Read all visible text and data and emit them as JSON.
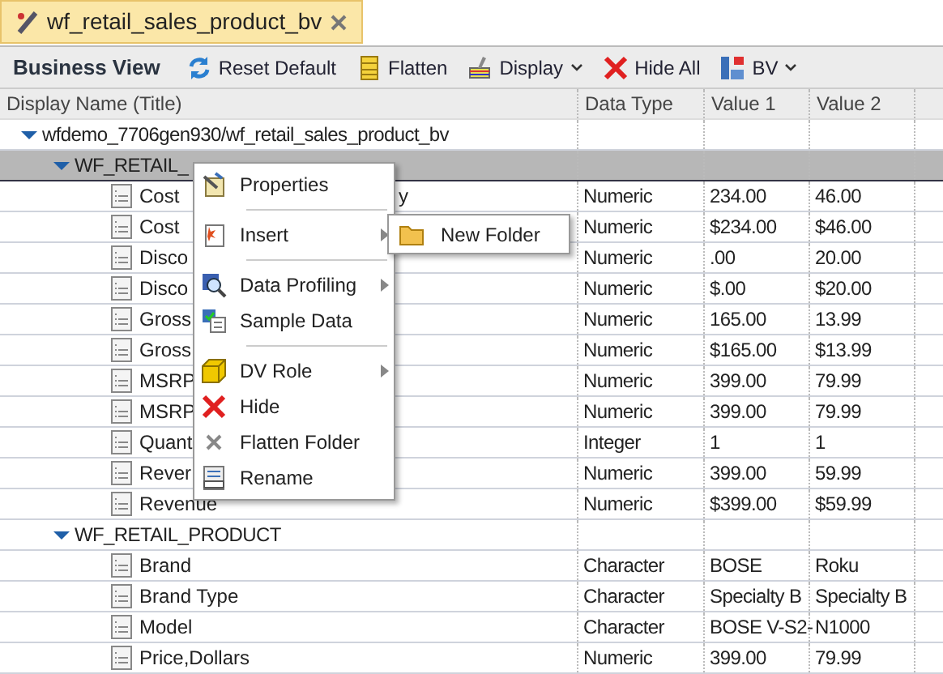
{
  "tab": {
    "title": "wf_retail_sales_product_bv",
    "selected": true
  },
  "toolbar": {
    "title": "Business View",
    "buttons": [
      {
        "label": "Reset Default",
        "dropdown": false
      },
      {
        "label": "Flatten",
        "dropdown": false
      },
      {
        "label": "Display",
        "dropdown": true
      },
      {
        "label": "Hide All",
        "dropdown": false
      },
      {
        "label": "BV",
        "dropdown": true
      }
    ]
  },
  "columns": [
    "Display Name (Title)",
    "Data Type",
    "Value 1",
    "Value 2"
  ],
  "tree": [
    {
      "name": "wfdemo_7706gen930/wf_retail_sales_product_bv",
      "kind": "folder",
      "expanded": true,
      "selected": false,
      "children": [
        {
          "name": "WF_RETAIL_",
          "kind": "folder",
          "expanded": true,
          "selected": true,
          "children": [
            {
              "name": "Cost",
              "tail": "y",
              "kind": "field",
              "type": "Numeric",
              "v1": "234.00",
              "v2": "46.00"
            },
            {
              "name": "Cost",
              "kind": "field",
              "type": "Numeric",
              "v1": "$234.00",
              "v2": "$46.00"
            },
            {
              "name": "Disco",
              "kind": "field",
              "type": "Numeric",
              "v1": ".00",
              "v2": "20.00"
            },
            {
              "name": "Disco",
              "kind": "field",
              "type": "Numeric",
              "v1": "$.00",
              "v2": "$20.00"
            },
            {
              "name": "Gross",
              "kind": "field",
              "type": "Numeric",
              "v1": "165.00",
              "v2": "13.99"
            },
            {
              "name": "Gross",
              "kind": "field",
              "type": "Numeric",
              "v1": "$165.00",
              "v2": "$13.99"
            },
            {
              "name": "MSRP",
              "kind": "field",
              "type": "Numeric",
              "v1": "399.00",
              "v2": "79.99"
            },
            {
              "name": "MSRP",
              "kind": "field",
              "type": "Numeric",
              "v1": "399.00",
              "v2": "79.99"
            },
            {
              "name": "Quant",
              "kind": "field",
              "type": "Integer",
              "v1": "1",
              "v2": "1"
            },
            {
              "name": "Rever",
              "kind": "field",
              "type": "Numeric",
              "v1": "399.00",
              "v2": "59.99"
            },
            {
              "name": "Revenue",
              "kind": "field",
              "type": "Numeric",
              "v1": "$399.00",
              "v2": "$59.99"
            }
          ]
        },
        {
          "name": "WF_RETAIL_PRODUCT",
          "kind": "folder",
          "expanded": true,
          "selected": false,
          "children": [
            {
              "name": "Brand",
              "kind": "field",
              "type": "Character",
              "v1": "BOSE",
              "v2": "Roku"
            },
            {
              "name": "Brand Type",
              "kind": "field",
              "type": "Character",
              "v1": "Specialty B",
              "v2": "Specialty B"
            },
            {
              "name": "Model",
              "kind": "field",
              "type": "Character",
              "v1": "BOSE V-S2-",
              "v2": "N1000"
            },
            {
              "name": "Price,Dollars",
              "kind": "field",
              "type": "Numeric",
              "v1": "399.00",
              "v2": "79.99"
            }
          ]
        }
      ]
    }
  ],
  "context_menu": [
    {
      "kind": "item",
      "label": "Properties",
      "submenu": false
    },
    {
      "kind": "separator"
    },
    {
      "kind": "item",
      "label": "Insert",
      "submenu": true,
      "open": true
    },
    {
      "kind": "separator"
    },
    {
      "kind": "item",
      "label": "Data Profiling",
      "submenu": true,
      "open": false
    },
    {
      "kind": "item",
      "label": "Sample Data",
      "submenu": false
    },
    {
      "kind": "separator"
    },
    {
      "kind": "item",
      "label": "DV Role",
      "submenu": true,
      "open": false
    },
    {
      "kind": "item",
      "label": "Hide",
      "submenu": false
    },
    {
      "kind": "item",
      "label": "Flatten Folder",
      "submenu": false
    },
    {
      "kind": "item",
      "label": "Rename",
      "submenu": false
    }
  ],
  "submenu": [
    {
      "label": "New Folder"
    }
  ]
}
